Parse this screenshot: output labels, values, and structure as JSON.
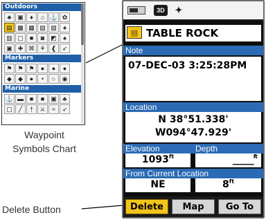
{
  "symbols_chart": {
    "categories": [
      {
        "name": "Outdoors",
        "rows": [
          [
            {
              "icon": "♣",
              "name": "tree"
            },
            {
              "icon": "▣",
              "name": "bridge"
            },
            {
              "icon": "♦",
              "name": "campground"
            },
            {
              "icon": "⌂",
              "name": "cabin"
            },
            {
              "icon": "⚓",
              "name": "anchor"
            },
            {
              "icon": "✿",
              "name": "park"
            }
          ],
          [
            {
              "icon": "▤",
              "name": "trail-head"
            },
            {
              "icon": "▩",
              "name": "picnic"
            },
            {
              "icon": "▦",
              "name": "building"
            },
            {
              "icon": "▧",
              "name": "shelter"
            },
            {
              "icon": "▨",
              "name": "lodge"
            },
            {
              "icon": "♠",
              "name": "forest"
            }
          ],
          [
            {
              "icon": "▥",
              "name": "table"
            },
            {
              "icon": "▢",
              "name": "restroom"
            },
            {
              "icon": "■",
              "name": "info"
            },
            {
              "icon": "◙",
              "name": "photo"
            },
            {
              "icon": "◩",
              "name": "boat"
            },
            {
              "icon": "♠",
              "name": "drinking"
            }
          ],
          [
            {
              "icon": "▣",
              "name": "geocache"
            },
            {
              "icon": "✚",
              "name": "first-aid"
            },
            {
              "icon": "⌘",
              "name": "summit"
            },
            {
              "icon": "⚘",
              "name": "scenic"
            },
            {
              "icon": "❰",
              "name": "skiing"
            },
            {
              "icon": "➶",
              "name": "fishing"
            }
          ]
        ]
      },
      {
        "name": "Markers",
        "rows": [
          [
            {
              "icon": "⚑",
              "name": "flag-blue"
            },
            {
              "icon": "⚑",
              "name": "flag-green"
            },
            {
              "icon": "⚑",
              "name": "flag-red"
            },
            {
              "icon": "●",
              "name": "pin-red"
            },
            {
              "icon": "●",
              "name": "pin-green"
            },
            {
              "icon": "●",
              "name": "pin-blue"
            }
          ],
          [
            {
              "icon": "◆",
              "name": "block-blue"
            },
            {
              "icon": "◆",
              "name": "block-green"
            },
            {
              "icon": "●",
              "name": "dot"
            },
            {
              "icon": "•",
              "name": "dot-small"
            },
            {
              "icon": "○",
              "name": "circle"
            },
            {
              "icon": "◉",
              "name": "target"
            }
          ]
        ]
      },
      {
        "name": "Marine",
        "rows": [
          [
            {
              "icon": "⚓",
              "name": "anchor"
            },
            {
              "icon": "▬",
              "name": "buoy"
            },
            {
              "icon": "■",
              "name": "marker-red"
            },
            {
              "icon": "■",
              "name": "marker-green"
            },
            {
              "icon": "▣",
              "name": "dive"
            },
            {
              "icon": "♣",
              "name": "shore"
            }
          ],
          [
            {
              "icon": "▢",
              "name": "dock"
            },
            {
              "icon": "╱",
              "name": "ramp"
            },
            {
              "icon": "†",
              "name": "beacon"
            },
            {
              "icon": "⚔",
              "name": "wreck"
            },
            {
              "icon": "≈",
              "name": "water"
            },
            {
              "icon": "➶",
              "name": "fish"
            }
          ]
        ]
      }
    ],
    "caption": [
      "Waypoint",
      "Symbols Chart"
    ]
  },
  "callout": {
    "delete_caption": "Delete Button"
  },
  "status_bar": {
    "fix_mode": "3D",
    "satellite_icon": "satellite-icon",
    "battery_icon": "battery-icon"
  },
  "waypoint": {
    "name": "TABLE ROCK",
    "symbol_icon": "▤",
    "note_label": "Note",
    "note": "07-DEC-03 3:25:28PM",
    "location_label": "Location",
    "latitude": "N  38°51.338'",
    "longitude": "W094°47.929'",
    "elevation_label": "Elevation",
    "depth_label": "Depth",
    "elevation": "1093",
    "elevation_unit": "ft",
    "depth": "_____",
    "depth_unit": "ft",
    "from_current_label": "From Current Location",
    "bearing": "NE",
    "distance": "8",
    "distance_unit": "ft"
  },
  "buttons": {
    "delete": "Delete",
    "map": "Map",
    "goto": "Go To"
  },
  "colors": {
    "header_blue": "#2b6bb5",
    "highlight_yellow": "#f3c51b"
  }
}
